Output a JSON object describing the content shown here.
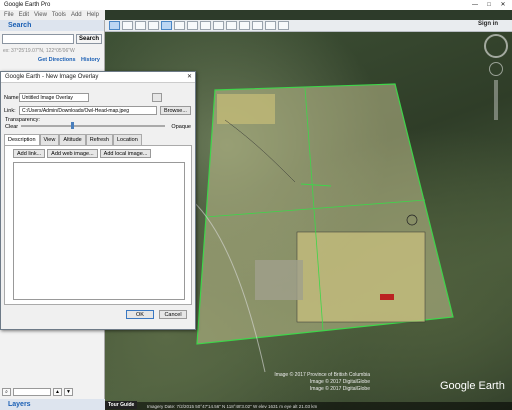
{
  "window": {
    "title": "Google Earth Pro",
    "controls": [
      "—",
      "□",
      "✕"
    ]
  },
  "menu": [
    "File",
    "Edit",
    "View",
    "Tools",
    "Add",
    "Help"
  ],
  "toolbar": {
    "signin": "Sign in"
  },
  "sidebar": {
    "search_header": "Search",
    "search_button": "Search",
    "search_value": "",
    "hint": "ex: 37°25'19.07\"N, 122°05'06\"W",
    "get_directions": "Get Directions",
    "history": "History",
    "layers_header": "Layers"
  },
  "dialog": {
    "title": "Google Earth - New Image Overlay",
    "close": "✕",
    "name_label": "Name:",
    "name_value": "Untitled Image Overlay",
    "link_label": "Link:",
    "link_value": "C:/Users/Admin/Downloads/Owl-Head-map.jpeg",
    "browse": "Browse...",
    "transparency_label": "Transparency:",
    "clear": "Clear",
    "opaque": "Opaque",
    "transparency_level": 0.35,
    "tabs": [
      "Description",
      "View",
      "Altitude",
      "Refresh",
      "Location"
    ],
    "add_link": "Add link...",
    "add_web_image": "Add web image...",
    "add_local_image": "Add local image...",
    "ok": "OK",
    "cancel": "Cancel"
  },
  "map": {
    "credits": [
      "Image © 2017 Province of British Columbia",
      "Image © 2017 DigitalGlobe",
      "Image © 2017 DigitalGlobe"
    ],
    "brand": "Google Earth",
    "tour_guide": "Tour Guide",
    "status": "Imagery Date: 7/2/2015   50°47'14.56\" N   118°48'3.02\" W   elev 1631 m   eye alt 21.03 km"
  }
}
